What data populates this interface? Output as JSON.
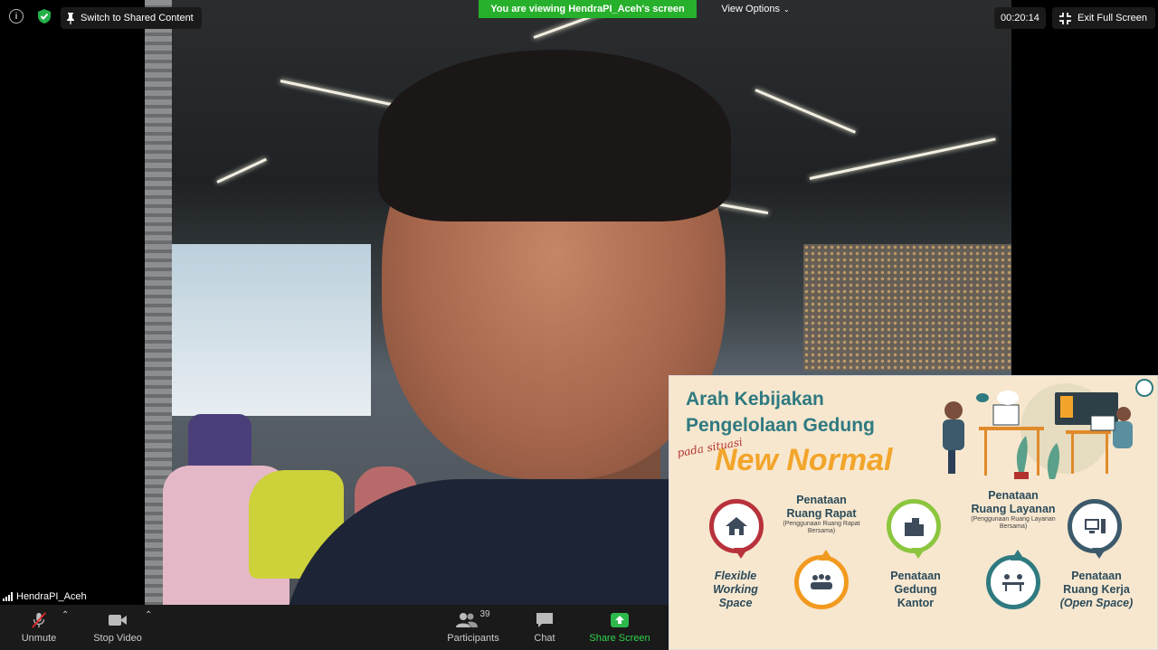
{
  "top_bar": {
    "info_icon": "info-icon",
    "security_icon": "shield-check-icon",
    "switch_label": "Switch to Shared Content",
    "viewing_banner": "You are viewing HendraPI_Aceh's screen",
    "view_options": "View Options",
    "timer": "00:20:14",
    "exit_fullscreen": "Exit Full Screen"
  },
  "participant": {
    "name": "HendraPI_Aceh"
  },
  "toolbar": {
    "unmute": "Unmute",
    "stop_video": "Stop Video",
    "participants": "Participants",
    "participant_count": "39",
    "chat": "Chat",
    "share_screen": "Share Screen"
  },
  "slide": {
    "title_line1": "Arah Kebijakan",
    "title_line2": "Pengelolaan Gedung",
    "pada_situasi": "pada situasi",
    "new_normal": "New Normal",
    "items": [
      {
        "label": "Flexible Working Space",
        "lines": [
          "Flexible",
          "Working",
          "Space"
        ],
        "color": "#b8323b"
      },
      {
        "label": "Penataan Ruang Rapat",
        "lines": [
          "Penataan",
          "Ruang Rapat"
        ],
        "sub": "(Penggunaan Ruang Rapat Bersama)",
        "color": "#f29a1f"
      },
      {
        "label": "Penataan Gedung Kantor",
        "lines": [
          "Penataan",
          "Gedung",
          "Kantor"
        ],
        "color": "#8cc63f"
      },
      {
        "label": "Penataan Ruang Layanan",
        "lines": [
          "Penataan",
          "Ruang Layanan"
        ],
        "sub": "(Penggunaan Ruang Layanan Bersama)",
        "color": "#2f7a80"
      },
      {
        "label": "Penataan Ruang Kerja (Open Space)",
        "lines": [
          "Penataan",
          "Ruang Kerja",
          "(Open Space)"
        ],
        "color": "#3c5a6b"
      }
    ]
  }
}
